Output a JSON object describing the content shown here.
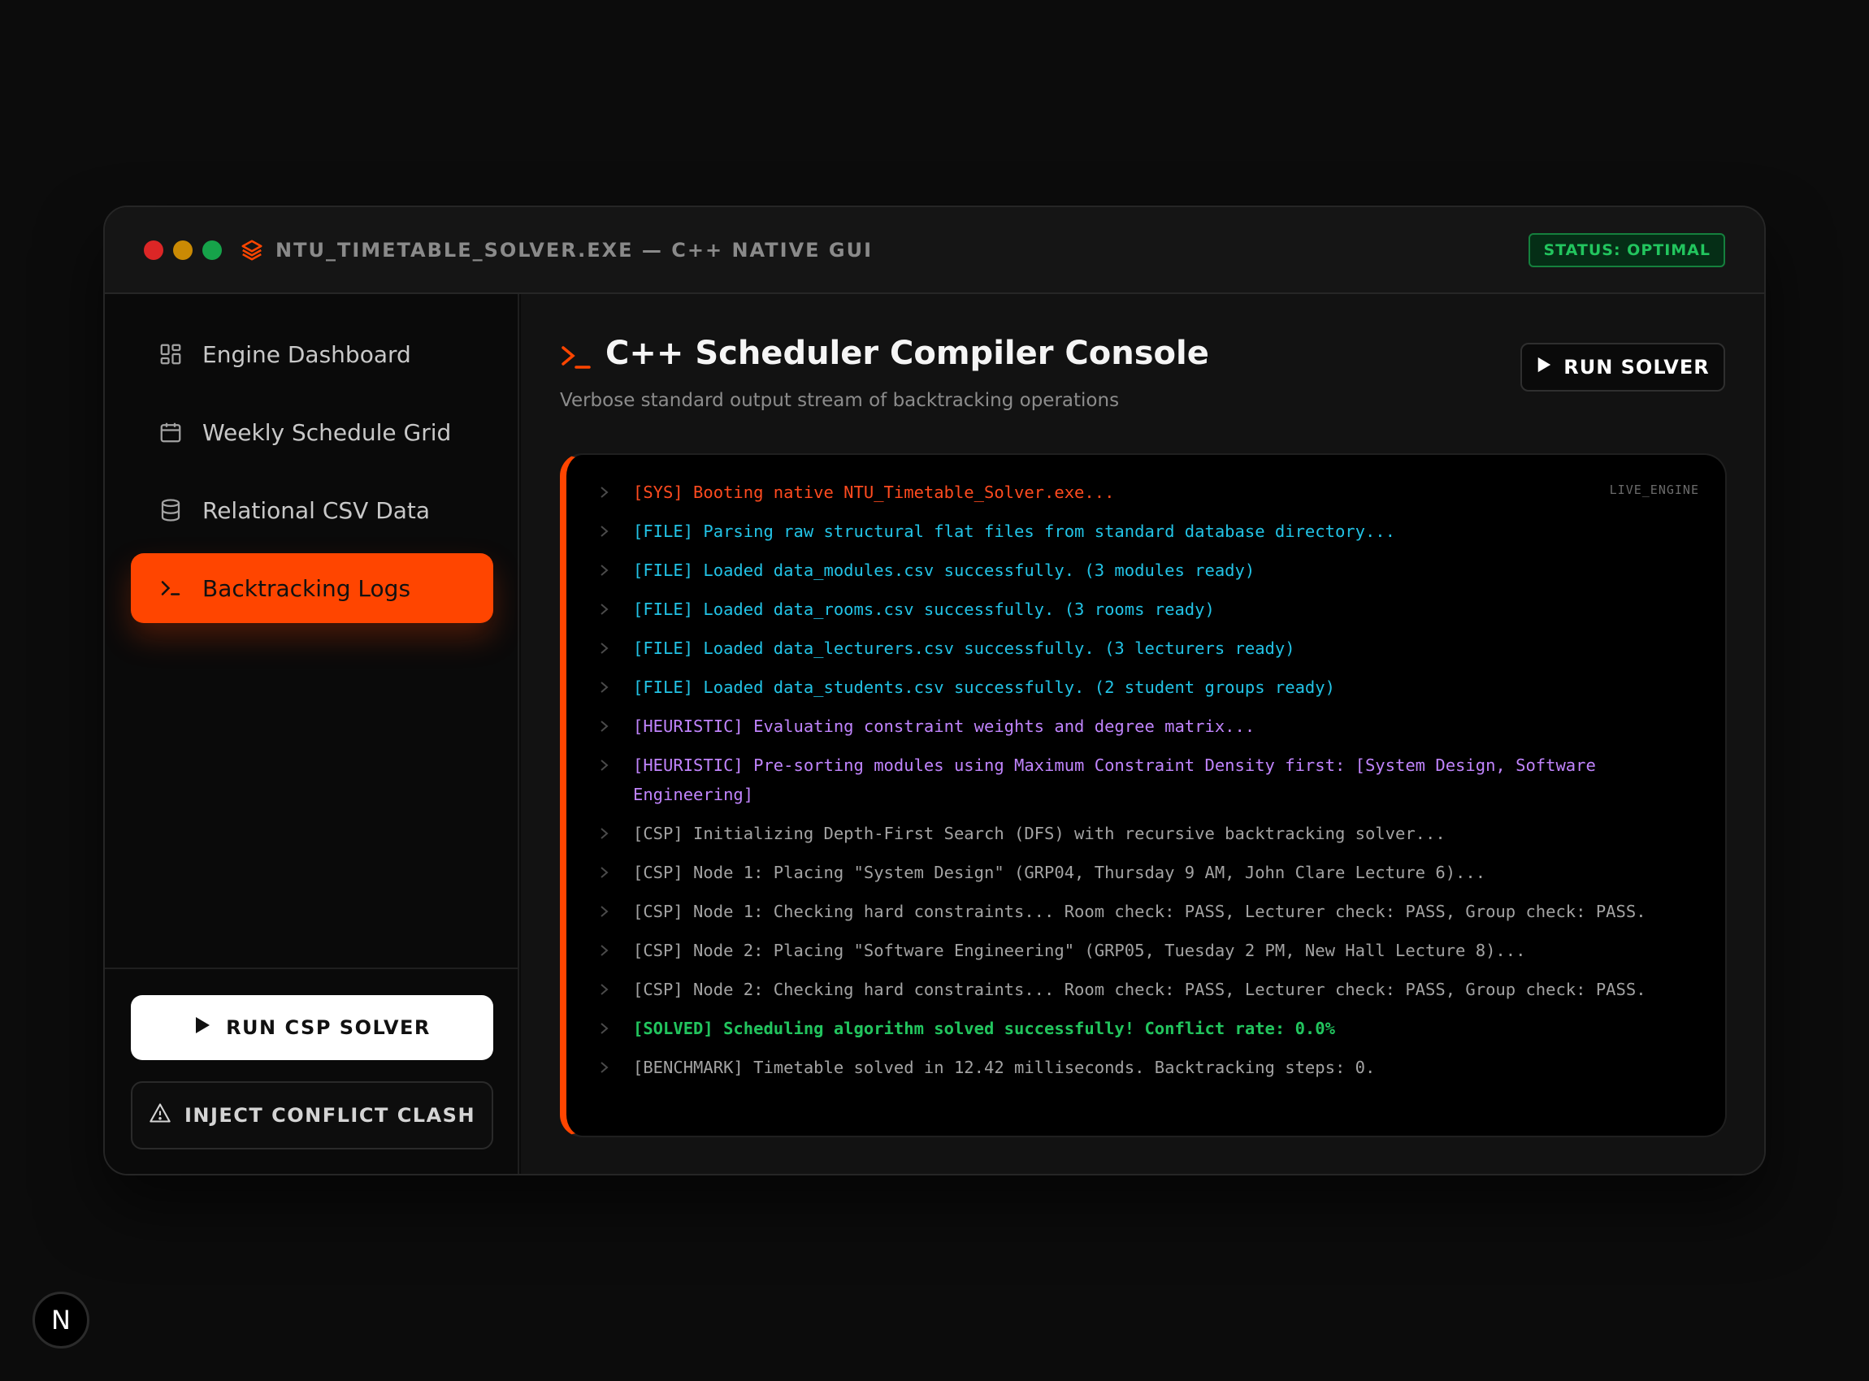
{
  "window": {
    "title": "NTU_TIMETABLE_SOLVER.EXE — C++ NATIVE GUI",
    "status": "STATUS: OPTIMAL"
  },
  "sidebar": {
    "items": [
      {
        "label": "Engine Dashboard",
        "icon": "dashboard-icon",
        "active": false
      },
      {
        "label": "Weekly Schedule Grid",
        "icon": "calendar-icon",
        "active": false
      },
      {
        "label": "Relational CSV Data",
        "icon": "database-icon",
        "active": false
      },
      {
        "label": "Backtracking Logs",
        "icon": "terminal-icon",
        "active": true
      }
    ],
    "run_csp_label": "RUN CSP SOLVER",
    "inject_label": "INJECT CONFLICT CLASH"
  },
  "main": {
    "title": "C++ Scheduler Compiler Console",
    "subtitle": "Verbose standard output stream of backtracking operations",
    "run_solver_label": "RUN SOLVER",
    "console_tag": "LIVE_ENGINE",
    "logs": [
      {
        "type": "sys",
        "text": "[SYS] Booting native NTU_Timetable_Solver.exe..."
      },
      {
        "type": "file",
        "text": "[FILE] Parsing raw structural flat files from standard database directory..."
      },
      {
        "type": "file",
        "text": "[FILE] Loaded data_modules.csv successfully. (3 modules ready)"
      },
      {
        "type": "file",
        "text": "[FILE] Loaded data_rooms.csv successfully. (3 rooms ready)"
      },
      {
        "type": "file",
        "text": "[FILE] Loaded data_lecturers.csv successfully. (3 lecturers ready)"
      },
      {
        "type": "file",
        "text": "[FILE] Loaded data_students.csv successfully. (2 student groups ready)"
      },
      {
        "type": "heur",
        "text": "[HEURISTIC] Evaluating constraint weights and degree matrix..."
      },
      {
        "type": "heur",
        "text": "[HEURISTIC] Pre-sorting modules using Maximum Constraint Density first: [System Design, Software Engineering]"
      },
      {
        "type": "csp",
        "text": "[CSP] Initializing Depth-First Search (DFS) with recursive backtracking solver..."
      },
      {
        "type": "csp",
        "text": "[CSP] Node 1: Placing \"System Design\" (GRP04, Thursday 9 AM, John Clare Lecture 6)..."
      },
      {
        "type": "csp",
        "text": "[CSP] Node 1: Checking hard constraints... Room check: PASS, Lecturer check: PASS, Group check: PASS."
      },
      {
        "type": "csp",
        "text": "[CSP] Node 2: Placing \"Software Engineering\" (GRP05, Tuesday 2 PM, New Hall Lecture 8)..."
      },
      {
        "type": "csp",
        "text": "[CSP] Node 2: Checking hard constraints... Room check: PASS, Lecturer check: PASS, Group check: PASS."
      },
      {
        "type": "solved",
        "text": "[SOLVED] Scheduling algorithm solved successfully! Conflict rate: 0.0%"
      },
      {
        "type": "bench",
        "text": "[BENCHMARK] Timetable solved in 12.42 milliseconds. Backtracking steps: 0."
      }
    ]
  },
  "colors": {
    "accent": "#ff4500",
    "status_green": "#22c55e",
    "file_cyan": "#22c3e6",
    "heuristic_purple": "#c084fc"
  },
  "corner_badge": "N"
}
